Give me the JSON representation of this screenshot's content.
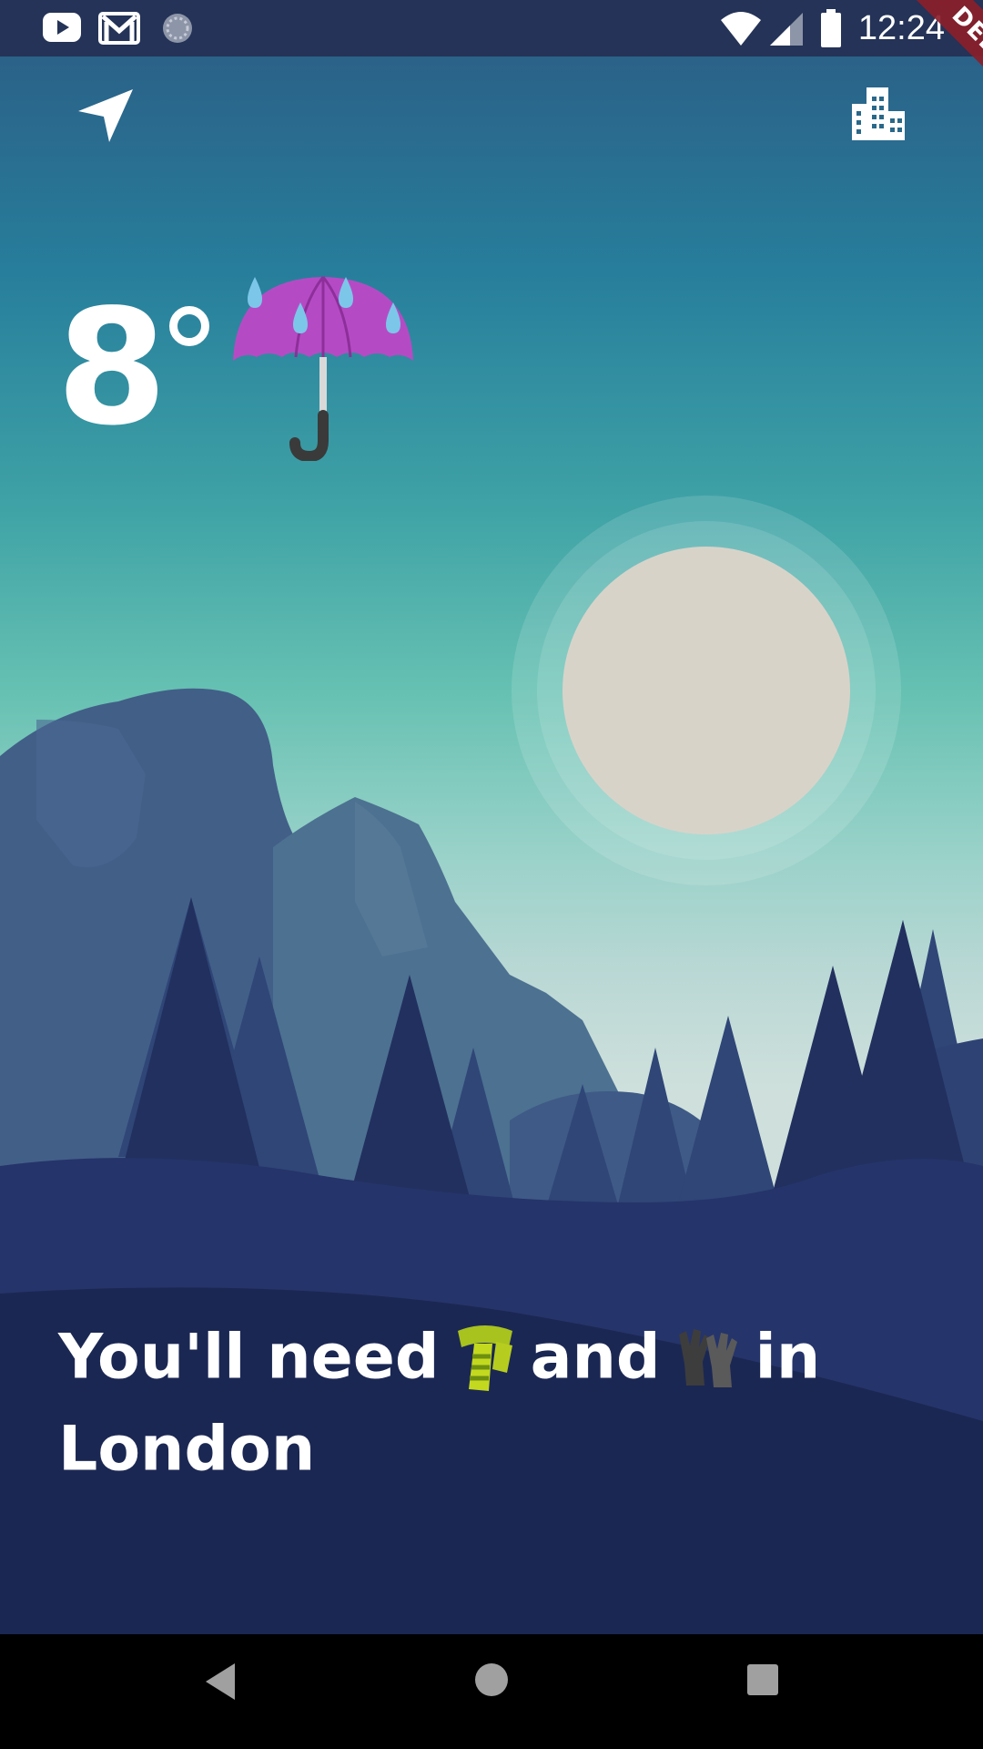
{
  "status_bar": {
    "time": "12:24",
    "left_icons": [
      "youtube-icon",
      "gmail-icon",
      "sync-icon"
    ],
    "right_icons": [
      "wifi-icon",
      "cellular-signal-icon",
      "battery-icon"
    ]
  },
  "debug_banner": {
    "label": "DEBUG",
    "color": "#8b1e2a"
  },
  "header": {
    "left_icon": "navigation-arrow-icon",
    "right_icon": "city-icon"
  },
  "weather": {
    "temperature": "8",
    "condition_icon": "umbrella-with-rain-icon"
  },
  "message": {
    "prefix": "You'll need",
    "item1_icon": "scarf-icon",
    "connector": "and",
    "item2_icon": "gloves-icon",
    "suffix": "in",
    "city": "London"
  },
  "nav_bar": {
    "icons": [
      "back-icon",
      "home-icon",
      "recents-icon"
    ]
  },
  "colors": {
    "sky_top": "#2c5a83",
    "sky_bottom": "#cfe0dc",
    "moon": "#d8d3c9",
    "forest_dark": "#1b2753",
    "text": "#ffffff"
  }
}
